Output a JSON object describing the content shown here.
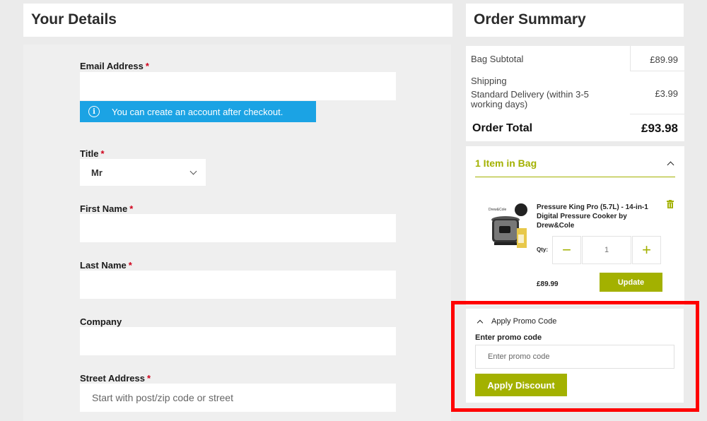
{
  "details": {
    "title": "Your Details",
    "email_label": "Email Address",
    "required_mark": "*",
    "account_info": "You can create an account after checkout.",
    "info_icon_glyph": "i",
    "title_label": "Title",
    "title_value": "Mr",
    "first_name_label": "First Name",
    "last_name_label": "Last Name",
    "company_label": "Company",
    "street_label": "Street Address",
    "street_placeholder": "Start with post/zip code or street"
  },
  "summary": {
    "title": "Order Summary",
    "subtotal_label": "Bag Subtotal",
    "subtotal_value": "£89.99",
    "shipping_label": "Shipping",
    "shipping_method": "Standard Delivery (within 3-5 working days)",
    "shipping_value": "£3.99",
    "total_label": "Order Total",
    "total_value": "£93.98"
  },
  "bag": {
    "heading": "1 Item in Bag",
    "product_name": "Pressure King Pro (5.7L) - 14-in-1 Digital Pressure Cooker by Drew&Cole",
    "qty_label": "Qty:",
    "qty_value": "1",
    "minus": "−",
    "plus": "+",
    "price": "£89.99",
    "update_label": "Update"
  },
  "promo": {
    "toggle_label": "Apply Promo Code",
    "field_label": "Enter promo code",
    "placeholder": "Enter promo code",
    "apply_label": "Apply Discount"
  },
  "colors": {
    "accent": "#a3b100",
    "info": "#1ba3e4",
    "highlight": "#ff0000"
  }
}
